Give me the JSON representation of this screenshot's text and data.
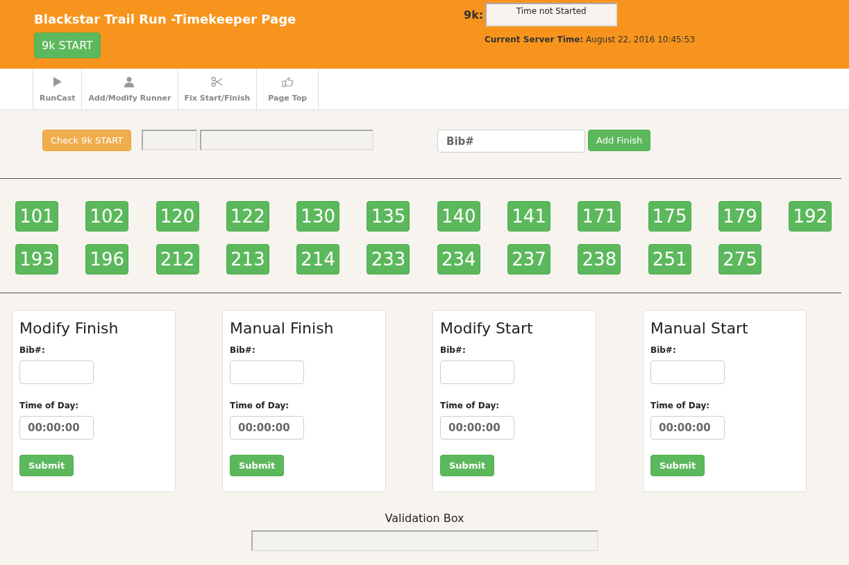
{
  "header": {
    "title": "Blackstar Trail Run -Timekeeper Page",
    "start_button": "9k START",
    "timer_label": "9k:",
    "timer_value": "Time not Started",
    "server_time_label": "Current Server Time:",
    "server_time": "August 22, 2016 10:45:53"
  },
  "nav": [
    {
      "label": "RunCast",
      "kind": "play"
    },
    {
      "label": "Add/Modify Runner",
      "kind": "user"
    },
    {
      "label": "Fix Start/Finish",
      "kind": "scissors"
    },
    {
      "label": "Page Top",
      "kind": "hand"
    }
  ],
  "controls": {
    "check_button": "Check 9k START",
    "bib_placeholder": "Bib#",
    "add_finish_button": "Add Finish"
  },
  "bibs": [
    "101",
    "102",
    "120",
    "122",
    "130",
    "135",
    "140",
    "141",
    "171",
    "175",
    "179",
    "192",
    "193",
    "196",
    "212",
    "213",
    "214",
    "233",
    "234",
    "237",
    "238",
    "251",
    "275"
  ],
  "forms": [
    {
      "title": "Modify Finish",
      "bib_label": "Bib#:",
      "time_label": "Time of Day:",
      "time_placeholder": "00:00:00",
      "submit": "Submit"
    },
    {
      "title": "Manual Finish",
      "bib_label": "Bib#:",
      "time_label": "Time of Day:",
      "time_placeholder": "00:00:00",
      "submit": "Submit"
    },
    {
      "title": "Modify Start",
      "bib_label": "Bib#:",
      "time_label": "Time of Day:",
      "time_placeholder": "00:00:00",
      "submit": "Submit"
    },
    {
      "title": "Manual Start",
      "bib_label": "Bib#:",
      "time_label": "Time of Day:",
      "time_placeholder": "00:00:00",
      "submit": "Submit"
    }
  ],
  "validation": {
    "title": "Validation Box"
  }
}
